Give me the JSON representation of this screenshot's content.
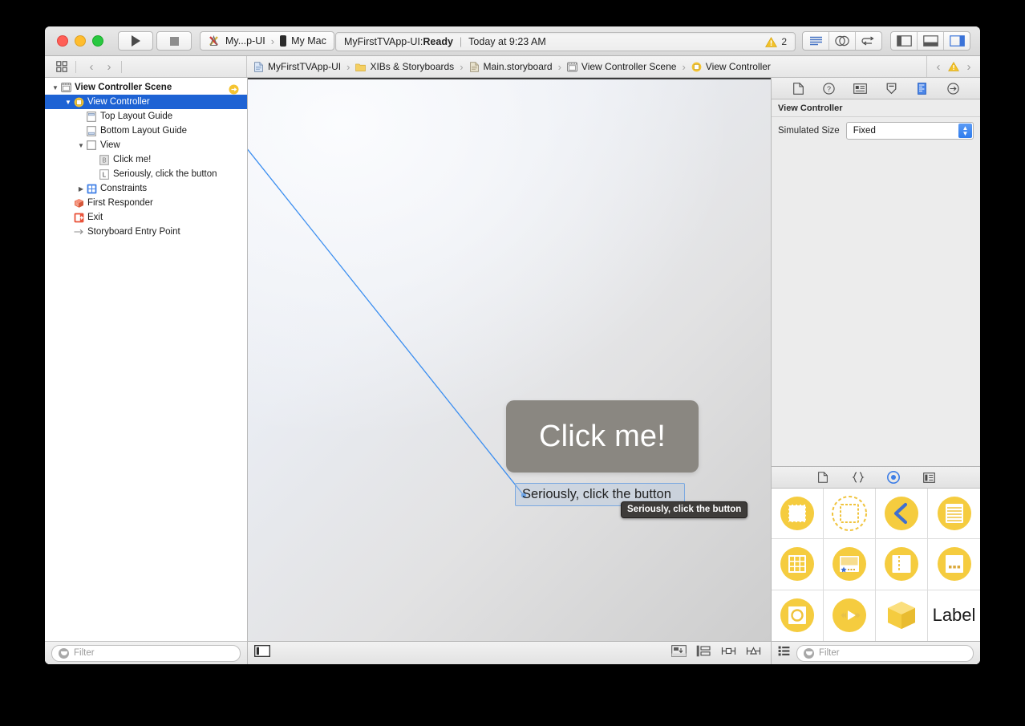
{
  "window": {
    "traffic_lights": [
      "close",
      "minimize",
      "zoom"
    ]
  },
  "toolbar": {
    "run_label": "Run",
    "stop_label": "Stop",
    "scheme_name": "My...p-UI",
    "destination": "My Mac",
    "status_project": "MyFirstTVApp-UI: ",
    "status_state": "Ready",
    "status_divider": "|",
    "status_time": "Today at 9:23 AM",
    "warning_count": "2",
    "editor_modes": [
      "standard-editor",
      "assistant-editor",
      "version-editor"
    ],
    "view_toggles": [
      "navigator-toggle",
      "debug-area-toggle",
      "utilities-toggle"
    ]
  },
  "jumpbar": {
    "back_label": "‹",
    "forward_label": "›",
    "crumbs": [
      {
        "label": "MyFirstTVApp-UI",
        "icon": "project-file-icon"
      },
      {
        "label": "XIBs & Storyboards",
        "icon": "folder-icon"
      },
      {
        "label": "Main.storyboard",
        "icon": "storyboard-file-icon"
      },
      {
        "label": "View Controller Scene",
        "icon": "scene-icon"
      },
      {
        "label": "View Controller",
        "icon": "view-controller-icon"
      }
    ],
    "separator": "›",
    "issue_prev": "‹",
    "issue_next": "›"
  },
  "outline": {
    "rows": [
      {
        "label": "View Controller Scene",
        "icon": "scene-icon",
        "indent": 0,
        "twisty": "▼",
        "bold": true,
        "selected": false,
        "badge": "entry-point-dot"
      },
      {
        "label": "View Controller",
        "icon": "view-controller-icon",
        "indent": 1,
        "twisty": "▼",
        "bold": false,
        "selected": true
      },
      {
        "label": "Top Layout Guide",
        "icon": "top-layout-guide-icon",
        "indent": 2,
        "twisty": "",
        "bold": false,
        "selected": false
      },
      {
        "label": "Bottom Layout Guide",
        "icon": "bottom-layout-guide-icon",
        "indent": 2,
        "twisty": "",
        "bold": false,
        "selected": false
      },
      {
        "label": "View",
        "icon": "view-icon",
        "indent": 2,
        "twisty": "▼",
        "bold": false,
        "selected": false
      },
      {
        "label": "Click me!",
        "icon": "button-icon",
        "indent": 3,
        "twisty": "",
        "bold": false,
        "selected": false
      },
      {
        "label": "Seriously, click the button",
        "icon": "label-icon",
        "indent": 3,
        "twisty": "",
        "bold": false,
        "selected": false
      },
      {
        "label": "Constraints",
        "icon": "constraints-icon",
        "indent": 2,
        "twisty": "▶",
        "bold": false,
        "selected": false
      },
      {
        "label": "First Responder",
        "icon": "first-responder-icon",
        "indent": 1,
        "twisty": "",
        "bold": false,
        "selected": false
      },
      {
        "label": "Exit",
        "icon": "exit-icon",
        "indent": 1,
        "twisty": "",
        "bold": false,
        "selected": false
      },
      {
        "label": "Storyboard Entry Point",
        "icon": "entry-point-arrow-icon",
        "indent": 1,
        "twisty": "",
        "bold": false,
        "selected": false
      }
    ],
    "filter_placeholder": "Filter"
  },
  "canvas": {
    "button_title": "Click me!",
    "label_text": "Seriously, click the button",
    "tooltip_text": "Seriously, click the button",
    "bottom_tools": [
      "align-button",
      "pin-button",
      "resolve-issues-button",
      "resizing-behavior-button"
    ],
    "zoom_toggle": "document-outline-toggle"
  },
  "inspector": {
    "tabs": [
      "file-inspector",
      "quick-help-inspector",
      "identity-inspector",
      "attributes-inspector",
      "size-inspector",
      "connections-inspector"
    ],
    "active_tab": "size-inspector",
    "section_title": "View Controller",
    "simulated_size_label": "Simulated Size",
    "simulated_size_value": "Fixed"
  },
  "library": {
    "tabs": [
      "file-template-library",
      "code-snippet-library",
      "object-library",
      "media-library"
    ],
    "active_tab": "object-library",
    "items": [
      {
        "name": "view-object",
        "type": "solid-rect"
      },
      {
        "name": "container-view-object",
        "type": "dashed-rect"
      },
      {
        "name": "navigation-back-object",
        "type": "chevron-left"
      },
      {
        "name": "table-view-object",
        "type": "lines"
      },
      {
        "name": "collection-view-object",
        "type": "grid"
      },
      {
        "name": "banner-view-object",
        "type": "banner"
      },
      {
        "name": "split-view-object",
        "type": "split"
      },
      {
        "name": "stack-view-object",
        "type": "dots-rect"
      },
      {
        "name": "image-view-object",
        "type": "image"
      },
      {
        "name": "player-view-object",
        "type": "player"
      },
      {
        "name": "object-cube",
        "type": "cube"
      },
      {
        "name": "label-object",
        "type": "text",
        "label": "Label"
      }
    ],
    "filter_placeholder": "Filter",
    "view_mode": "list-view-toggle"
  },
  "colors": {
    "selection_blue": "#1e63d4",
    "connection_line": "#3b8ef0",
    "library_yellow": "#f5cc3f",
    "warning_yellow": "#f3c229",
    "button_gray": "#8a8781",
    "tooltip_bg": "#3e3c3a"
  }
}
